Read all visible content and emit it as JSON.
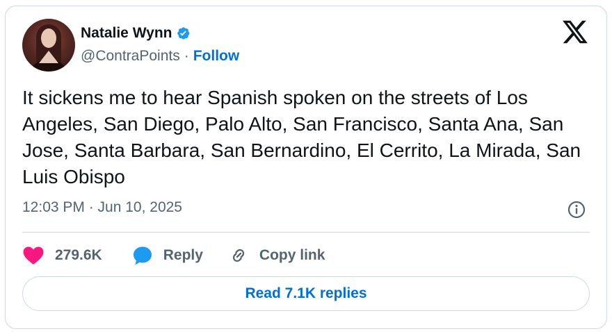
{
  "author": {
    "name": "Natalie Wynn",
    "handle": "@ContraPoints",
    "separator": "·",
    "follow_label": "Follow",
    "verified": true,
    "avatar_icon": "profile-photo"
  },
  "brand": {
    "logo": "x-logo-icon"
  },
  "tweet": {
    "text": "It sickens me to hear Spanish spoken on the streets of Los Angeles, San Diego, Palo Alto, San Francisco, Santa Ana, San Jose, Santa Barbara, San Bernardino, El Cerrito, La Mirada, San Luis Obispo",
    "timestamp": "12:03 PM · Jun 10, 2025"
  },
  "actions": {
    "like_count": "279.6K",
    "reply_label": "Reply",
    "copy_link_label": "Copy link"
  },
  "read_replies_label": "Read 7.1K replies",
  "colors": {
    "accent_link": "#006fd6",
    "verified_blue": "#1d9bf0",
    "like_pink": "#f91880",
    "muted_text": "#536471",
    "border": "#cfd9de"
  }
}
